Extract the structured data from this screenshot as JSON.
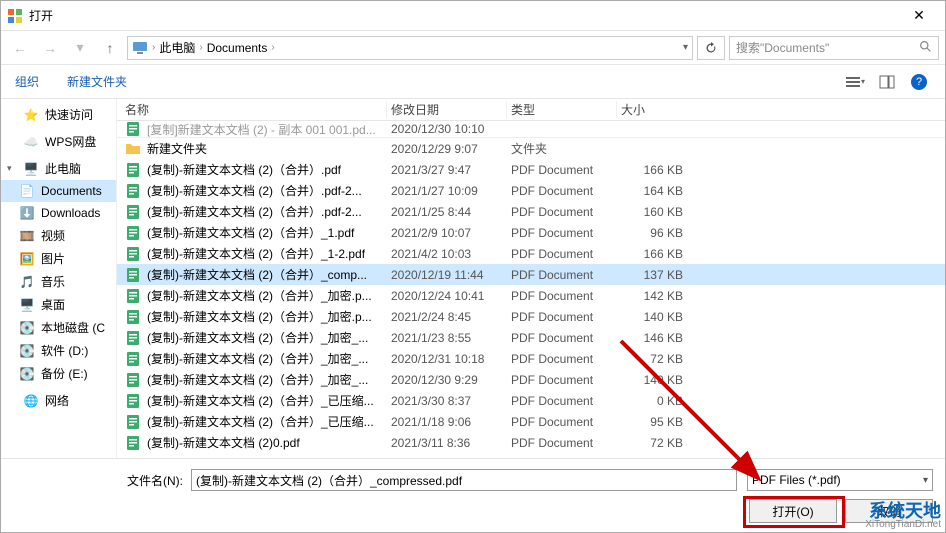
{
  "title": "打开",
  "breadcrumb": {
    "pc": "此电脑",
    "docs": "Documents"
  },
  "search_placeholder": "搜索\"Documents\"",
  "toolbar": {
    "organize": "组织",
    "newfolder": "新建文件夹"
  },
  "sidebar": {
    "quick": "快速访问",
    "wps": "WPS网盘",
    "thispc": "此电脑",
    "doc": "Documents",
    "dl": "Downloads",
    "video": "视频",
    "pic": "图片",
    "music": "音乐",
    "desktop": "桌面",
    "cdisk": "本地磁盘 (C",
    "ddisk": "软件 (D:)",
    "edisk": "备份 (E:)",
    "net": "网络"
  },
  "columns": {
    "name": "名称",
    "date": "修改日期",
    "type": "类型",
    "size": "大小"
  },
  "rows": [
    {
      "icon": "pdf",
      "name": "[复制]新建文本文档 (2) - 副本 001 001.pd...",
      "date": "2020/12/30 10:10",
      "type": "",
      "size": "",
      "cut": true
    },
    {
      "icon": "folder",
      "name": "新建文件夹",
      "date": "2020/12/29 9:07",
      "type": "文件夹",
      "size": ""
    },
    {
      "icon": "pdf",
      "name": "(复制)-新建文本文档 (2)（合并）.pdf",
      "date": "2021/3/27 9:47",
      "type": "PDF Document",
      "size": "166 KB"
    },
    {
      "icon": "pdf",
      "name": "(复制)-新建文本文档 (2)（合并）.pdf-2...",
      "date": "2021/1/27 10:09",
      "type": "PDF Document",
      "size": "164 KB"
    },
    {
      "icon": "pdf",
      "name": "(复制)-新建文本文档 (2)（合并）.pdf-2...",
      "date": "2021/1/25 8:44",
      "type": "PDF Document",
      "size": "160 KB"
    },
    {
      "icon": "pdf",
      "name": "(复制)-新建文本文档 (2)（合并）_1.pdf",
      "date": "2021/2/9 10:07",
      "type": "PDF Document",
      "size": "96 KB"
    },
    {
      "icon": "pdf",
      "name": "(复制)-新建文本文档 (2)（合并）_1-2.pdf",
      "date": "2021/4/2 10:03",
      "type": "PDF Document",
      "size": "166 KB"
    },
    {
      "icon": "pdf",
      "name": "(复制)-新建文本文档 (2)（合并）_comp...",
      "date": "2020/12/19 11:44",
      "type": "PDF Document",
      "size": "137 KB",
      "selected": true
    },
    {
      "icon": "pdf",
      "name": "(复制)-新建文本文档 (2)（合并）_加密.p...",
      "date": "2020/12/24 10:41",
      "type": "PDF Document",
      "size": "142 KB"
    },
    {
      "icon": "pdf",
      "name": "(复制)-新建文本文档 (2)（合并）_加密.p...",
      "date": "2021/2/24 8:45",
      "type": "PDF Document",
      "size": "140 KB"
    },
    {
      "icon": "pdf",
      "name": "(复制)-新建文本文档 (2)（合并）_加密_...",
      "date": "2021/1/23 8:55",
      "type": "PDF Document",
      "size": "146 KB"
    },
    {
      "icon": "pdf",
      "name": "(复制)-新建文本文档 (2)（合并）_加密_...",
      "date": "2020/12/31 10:18",
      "type": "PDF Document",
      "size": "72 KB"
    },
    {
      "icon": "pdf",
      "name": "(复制)-新建文本文档 (2)（合并）_加密_...",
      "date": "2020/12/30 9:29",
      "type": "PDF Document",
      "size": "140 KB"
    },
    {
      "icon": "pdf",
      "name": "(复制)-新建文本文档 (2)（合并）_已压缩...",
      "date": "2021/3/30 8:37",
      "type": "PDF Document",
      "size": "0 KB"
    },
    {
      "icon": "pdf",
      "name": "(复制)-新建文本文档 (2)（合并）_已压缩...",
      "date": "2021/1/18 9:06",
      "type": "PDF Document",
      "size": "95 KB"
    },
    {
      "icon": "pdf",
      "name": "(复制)-新建文本文档 (2)0.pdf",
      "date": "2021/3/11 8:36",
      "type": "PDF Document",
      "size": "72 KB"
    }
  ],
  "footer": {
    "fname_label": "文件名(N):",
    "fname_value": "(复制)-新建文本文档 (2)（合并）_compressed.pdf",
    "filter": "PDF Files (*.pdf)",
    "open": "打开(O)",
    "cancel": "取消"
  },
  "watermark": {
    "big": "系统天地",
    "small": "XiTongTianDi.net"
  }
}
